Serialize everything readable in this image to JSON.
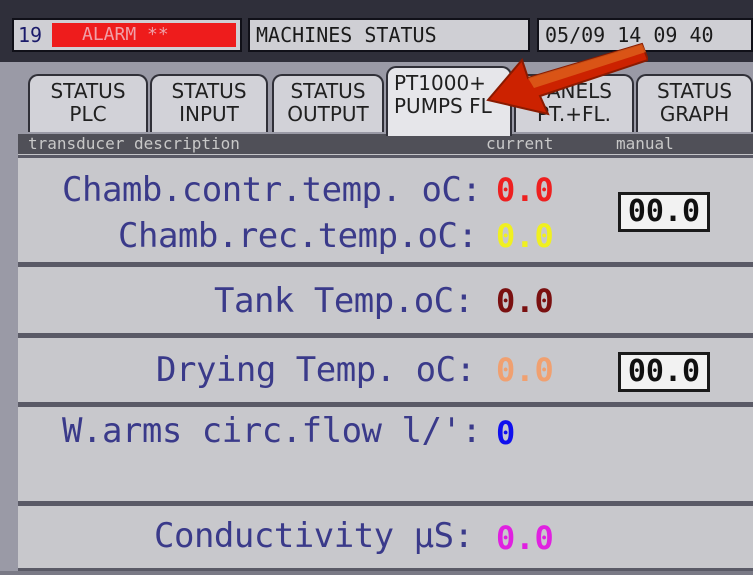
{
  "topbar": {
    "alarm_number": "19",
    "alarm_text": "ALARM **",
    "title": "MACHINES STATUS",
    "datetime": "05/09 14  09 40"
  },
  "tabs": [
    {
      "line1": "STATUS",
      "line2": "PLC"
    },
    {
      "line1": "STATUS",
      "line2": "INPUT"
    },
    {
      "line1": "STATUS",
      "line2": "OUTPUT"
    },
    {
      "line1": "PT1000+",
      "line2": "PUMPS FL"
    },
    {
      "line1": "PANELS",
      "line2": "PT.+FL."
    },
    {
      "line1": "STATUS",
      "line2": "GRAPH"
    }
  ],
  "header": {
    "description": "transducer description",
    "current": "current",
    "manual": "manual"
  },
  "rows": {
    "chamb_contr": {
      "label": "Chamb.contr.temp. oC:",
      "value": "0.0",
      "color": "#ee2020",
      "manual": "00.0"
    },
    "chamb_rec": {
      "label": "Chamb.rec.temp.oC:",
      "value": "0.0",
      "color": "#f0f020"
    },
    "tank": {
      "label": "Tank Temp.oC:",
      "value": "0.0",
      "color": "#7a1010"
    },
    "drying": {
      "label": "Drying Temp. oC:",
      "value": "0.0",
      "color": "#f0a070",
      "manual": "00.0"
    },
    "warms": {
      "label": "W.arms circ.flow l/':",
      "value": "0",
      "color": "#1010ee"
    },
    "conductivity": {
      "label": "Conductivity μS:",
      "value": "0.0",
      "color": "#e020e0"
    }
  },
  "colors": {
    "alarm_flag": "#ee1c1c",
    "label_text": "#3a3a8a",
    "arrow": "#cc2200"
  },
  "icons": {
    "pointer": "red-arrow-icon"
  }
}
